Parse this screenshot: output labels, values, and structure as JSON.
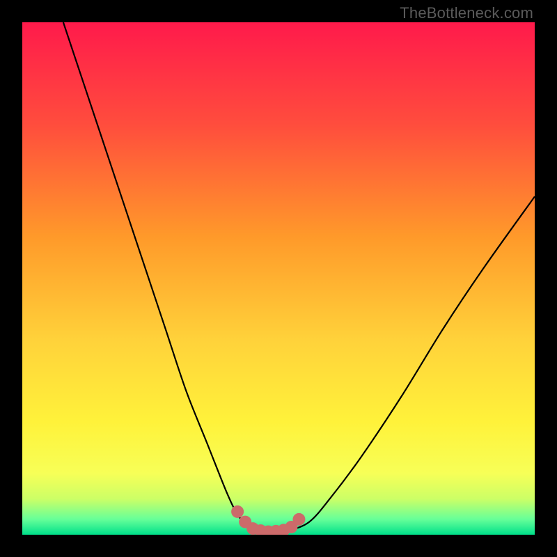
{
  "watermark": "TheBottleneck.com",
  "colors": {
    "frame": "#000000",
    "gradient_stops": [
      {
        "pct": 0,
        "color": "#ff1a4b"
      },
      {
        "pct": 20,
        "color": "#ff4d3d"
      },
      {
        "pct": 42,
        "color": "#ff9a2a"
      },
      {
        "pct": 62,
        "color": "#ffd23a"
      },
      {
        "pct": 78,
        "color": "#fff23a"
      },
      {
        "pct": 88,
        "color": "#f7ff57"
      },
      {
        "pct": 93,
        "color": "#ccff66"
      },
      {
        "pct": 97,
        "color": "#66ff99"
      },
      {
        "pct": 100,
        "color": "#00e08a"
      }
    ],
    "curve": "#000000",
    "marker": "#cc6a6a"
  },
  "chart_data": {
    "type": "line",
    "title": "",
    "xlabel": "",
    "ylabel": "",
    "xlim": [
      0,
      100
    ],
    "ylim": [
      0,
      100
    ],
    "series": [
      {
        "name": "bottleneck-curve",
        "x": [
          8,
          12,
          16,
          20,
          24,
          28,
          32,
          36,
          40,
          42,
          44,
          46,
          48,
          50,
          52,
          56,
          60,
          66,
          74,
          82,
          90,
          100
        ],
        "y": [
          100,
          88,
          76,
          64,
          52,
          40,
          28,
          18,
          8,
          4,
          1.5,
          0.8,
          0.6,
          0.6,
          0.8,
          2.5,
          7,
          15,
          27,
          40,
          52,
          66
        ]
      }
    ],
    "markers": {
      "name": "highlighted-points",
      "x": [
        42,
        43.5,
        45,
        46.5,
        48,
        49.5,
        51,
        52.5,
        54
      ],
      "y": [
        4.5,
        2.5,
        1.2,
        0.8,
        0.6,
        0.7,
        0.9,
        1.5,
        3.0
      ]
    }
  }
}
